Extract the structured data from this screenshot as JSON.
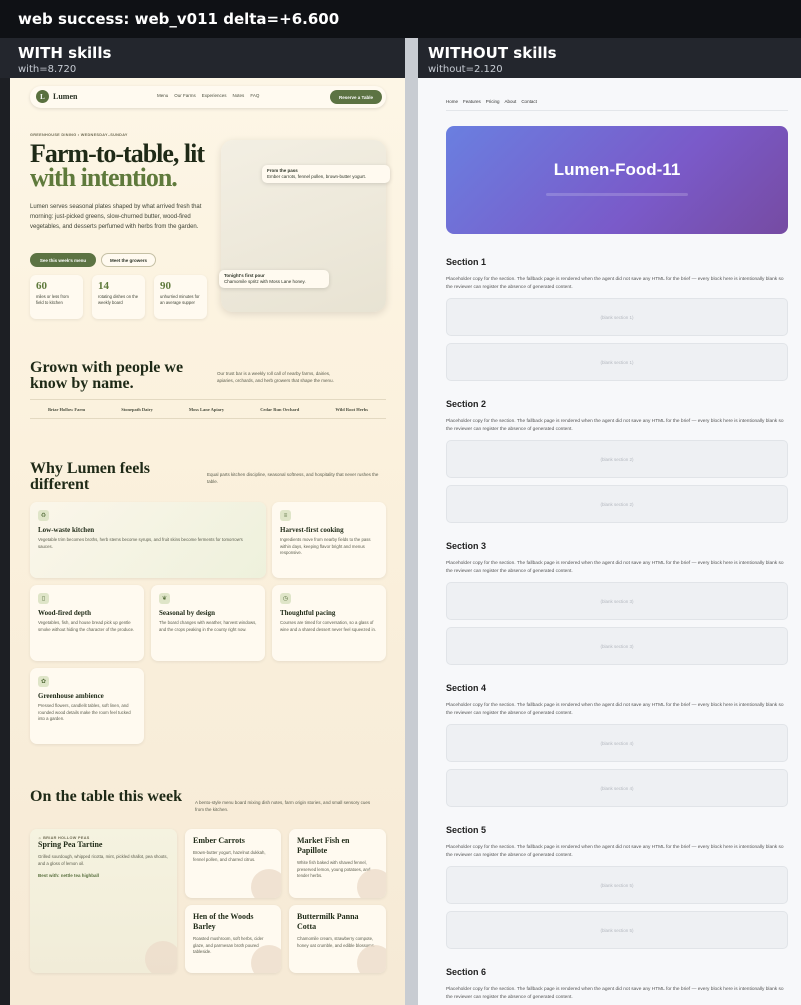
{
  "header": {
    "title": "web success: web_v011  delta=+6.600"
  },
  "columns": {
    "with": {
      "label": "WITH skills",
      "score": "with=8.720"
    },
    "without": {
      "label": "WITHOUT skills",
      "score": "without=2.120"
    }
  },
  "lumen": {
    "brand": "Lumen",
    "brand_initial": "L",
    "nav": [
      "Menu",
      "Our Farms",
      "Experiences",
      "Notes",
      "FAQ"
    ],
    "cta": "Reserve a Table",
    "eyebrow": "GREENHOUSE DINING • WEDNESDAY–SUNDAY",
    "hero_title_1": "Farm-to-table, lit",
    "hero_title_2": "with intention.",
    "hero_desc": "Lumen serves seasonal plates shaped by what arrived fresh that morning: just-picked greens, slow-churned butter, wood-fired vegetables, and desserts perfumed with herbs from the garden.",
    "btn_primary": "See this week's menu",
    "btn_secondary": "Meet the growers",
    "stats": [
      {
        "n": "60",
        "l": "miles or less from field to kitchen"
      },
      {
        "n": "14",
        "l": "rotating dishes on the weekly board"
      },
      {
        "n": "90",
        "l": "unhurried minutes for an average supper"
      }
    ],
    "pass_title": "From the pass",
    "pass_text": "Ember carrots, fennel pollen, brown-butter yogurt.",
    "pour_title": "Tonight's first pour",
    "pour_text": "Chamomile spritz with Moss Lane honey.",
    "grown_title": "Grown with people we know by name.",
    "grown_desc": "Our trust bar is a weekly roll call of nearby farms, dairies, apiaries, orchards, and herb growers that shape the menu.",
    "farms": [
      "Briar Hollow Farm",
      "Stonepath Dairy",
      "Moss Lane Apiary",
      "Cedar Run Orchard",
      "Wild Root Herbs"
    ],
    "why_title": "Why Lumen feels different",
    "why_desc": "Equal parts kitchen discipline, seasonal softness, and hospitality that never rushes the table.",
    "features": [
      {
        "icon": "♻",
        "icon_name": "recycle-icon",
        "t": "Low-waste kitchen",
        "d": "Vegetable trim becomes broths, herb stems become syrups, and fruit skins become ferments for tomorrow's sauces."
      },
      {
        "icon": "≡",
        "icon_name": "harvest-icon",
        "t": "Harvest-first cooking",
        "d": "Ingredients move from nearby fields to the pass within days, keeping flavor bright and menus responsive."
      },
      {
        "icon": "▯",
        "icon_name": "oven-icon",
        "t": "Wood-fired depth",
        "d": "Vegetables, fish, and house bread pick up gentle smoke without hiding the character of the produce."
      },
      {
        "icon": "❦",
        "icon_name": "leaf-icon",
        "t": "Seasonal by design",
        "d": "The board changes with weather, harvest windows, and the crops peaking in the county right now."
      },
      {
        "icon": "◷",
        "icon_name": "clock-icon",
        "t": "Thoughtful pacing",
        "d": "Courses are timed for conversation, so a glass of wine and a shared dessert never feel squeezed in."
      },
      {
        "icon": "✿",
        "icon_name": "flower-icon",
        "t": "Greenhouse ambience",
        "d": "Pressed flowers, candlelit tables, soft linen, and rounded wood details make the room feel tucked into a garden."
      }
    ],
    "table_title": "On the table this week",
    "table_desc": "A bento-style menu board mixing dish notes, farm origin stories, and small sensory cues from the kitchen.",
    "menu": [
      {
        "tag": "☼ BRIAR HOLLOW PEAS",
        "t": "Spring Pea Tartine",
        "d": "Grilled sourdough, whipped ricotta, mint, pickled shallot, pea shoots, and a gloss of lemon oil.",
        "pair": "Best with: nettle tea highball"
      },
      {
        "t": "Ember Carrots",
        "d": "Brown-butter yogurt, hazelnut dukkah, fennel pollen, and charred citrus."
      },
      {
        "t": "Market Fish en Papillote",
        "d": "White fish baked with shaved fennel, preserved lemon, young potatoes, and tender herbs."
      },
      {
        "t": "Hen of the Woods Barley",
        "d": "Roasted mushroom, soft herbs, cider glaze, and parmesan broth poured tableside."
      },
      {
        "t": "Buttermilk Panna Cotta",
        "d": "Chamomile cream, strawberry compote, honey oat crumble, and edible blossoms."
      }
    ]
  },
  "fallback": {
    "nav": [
      "Home",
      "Features",
      "Pricing",
      "About",
      "Contact"
    ],
    "banner_title": "Lumen-Food-11",
    "sections": [
      {
        "title": "Section 1",
        "text": "Placeholder copy for the section. The fallback page is rendered when the agent did not save any HTML for the brief — every block here is intentionally blank so the reviewer can register the absence of generated content.",
        "block": "(blank section 1)"
      },
      {
        "title": "Section 2",
        "text": "Placeholder copy for the section. The fallback page is rendered when the agent did not save any HTML for the brief — every block here is intentionally blank so the reviewer can register the absence of generated content.",
        "block": "(blank section 2)"
      },
      {
        "title": "Section 3",
        "text": "Placeholder copy for the section. The fallback page is rendered when the agent did not save any HTML for the brief — every block here is intentionally blank so the reviewer can register the absence of generated content.",
        "block": "(blank section 3)"
      },
      {
        "title": "Section 4",
        "text": "Placeholder copy for the section. The fallback page is rendered when the agent did not save any HTML for the brief — every block here is intentionally blank so the reviewer can register the absence of generated content.",
        "block": "(blank section 4)"
      },
      {
        "title": "Section 5",
        "text": "Placeholder copy for the section. The fallback page is rendered when the agent did not save any HTML for the brief — every block here is intentionally blank so the reviewer can register the absence of generated content.",
        "block": "(blank section 5)"
      },
      {
        "title": "Section 6",
        "text": "Placeholder copy for the section. The fallback page is rendered when the agent did not save any HTML for the brief — every block here is intentionally blank so the reviewer can register the absence of generated content."
      }
    ]
  }
}
